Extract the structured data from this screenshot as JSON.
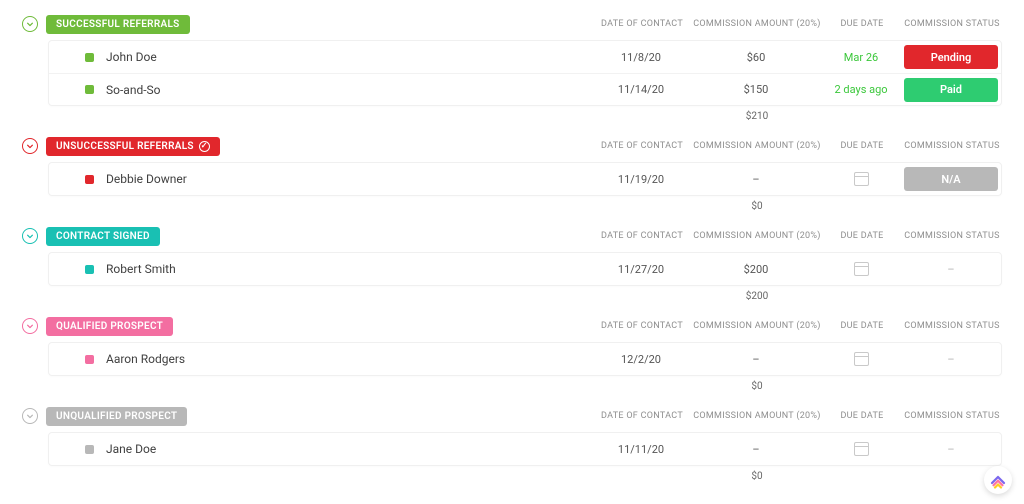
{
  "columns": {
    "date": "DATE OF CONTACT",
    "commission": "COMMISSION AMOUNT (20%)",
    "due": "DUE DATE",
    "status": "COMMISSION STATUS"
  },
  "colors": {
    "green": "#6fbb3a",
    "red": "#e1272c",
    "teal": "#19c0b3",
    "pink": "#f36ea1",
    "gray": "#b8b8b8",
    "statusPending": "#e1272c",
    "statusPaid": "#2ecc71",
    "statusNA": "#b8b8b8"
  },
  "groups": [
    {
      "title": "SUCCESSFUL REFERRALS",
      "color": "green",
      "badge": false,
      "rows": [
        {
          "name": "John Doe",
          "date": "11/8/20",
          "commission": "$60",
          "due": "Mar 26",
          "dueGreen": true,
          "status": "Pending",
          "statusColor": "statusPending",
          "showCal": false
        },
        {
          "name": "So-and-So",
          "date": "11/14/20",
          "commission": "$150",
          "due": "2 days ago",
          "dueGreen": true,
          "status": "Paid",
          "statusColor": "statusPaid",
          "showCal": false
        }
      ],
      "total": "$210"
    },
    {
      "title": "UNSUCCESSFUL REFERRALS",
      "color": "red",
      "badge": true,
      "rows": [
        {
          "name": "Debbie Downer",
          "date": "11/19/20",
          "commission": "–",
          "due": "",
          "dueGreen": false,
          "status": "N/A",
          "statusColor": "statusNA",
          "showCal": true
        }
      ],
      "total": "$0"
    },
    {
      "title": "CONTRACT SIGNED",
      "color": "teal",
      "badge": false,
      "rows": [
        {
          "name": "Robert Smith",
          "date": "11/27/20",
          "commission": "$200",
          "due": "",
          "dueGreen": false,
          "status": "–",
          "statusColor": "",
          "showCal": true
        }
      ],
      "total": "$200"
    },
    {
      "title": "QUALIFIED PROSPECT",
      "color": "pink",
      "badge": false,
      "rows": [
        {
          "name": "Aaron Rodgers",
          "date": "12/2/20",
          "commission": "–",
          "due": "",
          "dueGreen": false,
          "status": "–",
          "statusColor": "",
          "showCal": true
        }
      ],
      "total": "$0"
    },
    {
      "title": "UNQUALIFIED PROSPECT",
      "color": "gray",
      "badge": false,
      "rows": [
        {
          "name": "Jane Doe",
          "date": "11/11/20",
          "commission": "–",
          "due": "",
          "dueGreen": false,
          "status": "–",
          "statusColor": "",
          "showCal": true
        }
      ],
      "total": "$0"
    }
  ]
}
